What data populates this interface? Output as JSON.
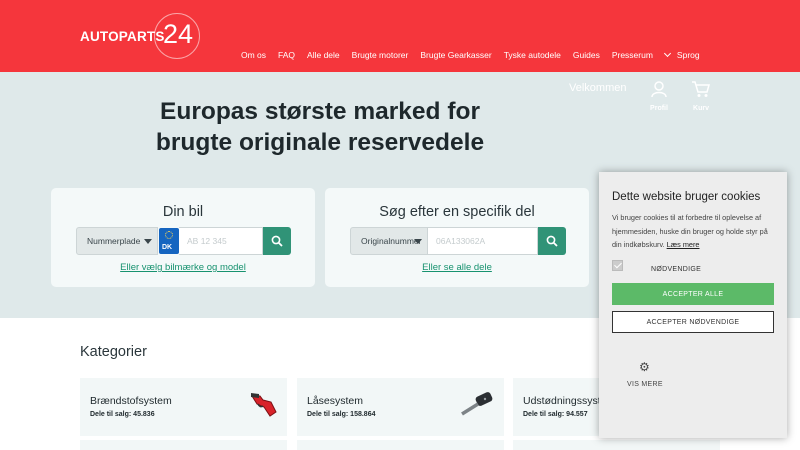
{
  "header": {
    "logo_text": "AUTOPARTS",
    "logo_number": "24",
    "nav": [
      "Om os",
      "FAQ",
      "Alle dele",
      "Brugte motorer",
      "Brugte Gearkasser",
      "Tyske autodele",
      "Guides",
      "Presserum"
    ],
    "language_label": "Sprog",
    "welcome": "Velkommen",
    "profile_label": "Profil",
    "cart_label": "Kurv",
    "brand_color": "#f5363c"
  },
  "hero": {
    "title_line1": "Europas største marked for",
    "title_line2": "brugte originale reservedele"
  },
  "car_search": {
    "title": "Din bil",
    "select_value": "Nummerplade",
    "country": "DK",
    "input_placeholder": "AB 12 345",
    "link": "Eller vælg bilmærke og model"
  },
  "part_search": {
    "title": "Søg efter en specifik del",
    "select_value": "Originalnummer",
    "input_placeholder": "06A133062A",
    "link": "Eller se alle dele"
  },
  "categories": {
    "heading": "Kategorier",
    "items": [
      {
        "name": "Brændstofsystem",
        "count": "Dele til salg: 45.836",
        "icon": "fuel-nozzle-icon"
      },
      {
        "name": "Låsesystem",
        "count": "Dele til salg: 158.864",
        "icon": "car-key-icon"
      },
      {
        "name": "Udstødningssystem",
        "count": "Dele til salg: 94.557",
        "icon": "exhaust-icon"
      }
    ]
  },
  "cookie": {
    "title": "Dette website bruger cookies",
    "text": "Vi bruger cookies til at forbedre til oplevelse af hjemmesiden, huske din bruger og holde styr på din indkøbskurv.",
    "more_link": "Læs mere",
    "necessary_label": "NØDVENDIGE",
    "accept_all": "ACCEPTER ALLE",
    "accept_necessary": "ACCEPTER NØDVENDIGE",
    "show_more": "VIS MERE"
  }
}
